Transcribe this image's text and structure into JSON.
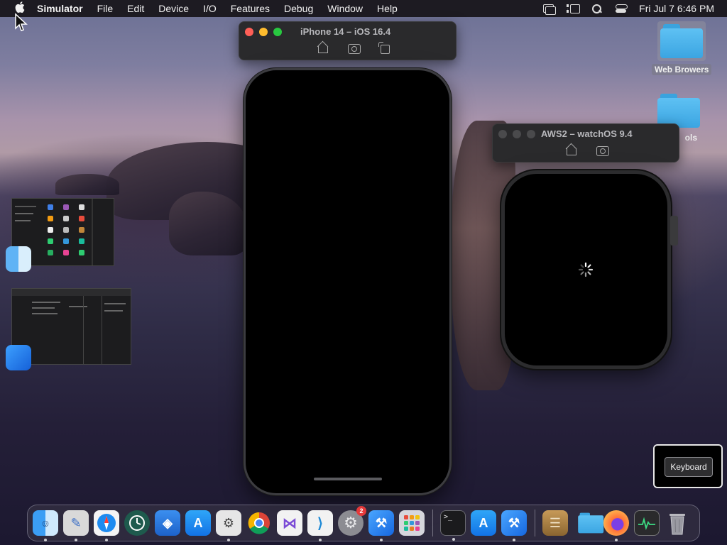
{
  "menubar": {
    "app_name": "Simulator",
    "items": [
      "File",
      "Edit",
      "Device",
      "I/O",
      "Features",
      "Debug",
      "Window",
      "Help"
    ],
    "clock": "Fri Jul 7  6:46 PM"
  },
  "iphone_sim": {
    "title": "iPhone 14 – iOS 16.4"
  },
  "watch_sim": {
    "title": "AWS2 – watchOS 9.4"
  },
  "desktop": {
    "folders": [
      {
        "label": "Web Browers"
      },
      {
        "label": "ols"
      }
    ]
  },
  "keyboard_panel": {
    "button_label": "Keyboard"
  },
  "dock": {
    "settings_badge": "2",
    "apps": [
      "finder",
      "sketch-pad",
      "safari",
      "time-machine",
      "cloud-app",
      "app-store",
      "xcode-instruments",
      "chrome",
      "visual-studio",
      "vscode",
      "system-settings",
      "xcode",
      "launchpad",
      "terminal",
      "app-store-2",
      "xcode-2",
      "archive-utility",
      "downloads-folder",
      "firefox",
      "activity-monitor",
      "trash"
    ]
  },
  "colors": {
    "traffic_red": "#ff5f57",
    "traffic_yellow": "#febc2e",
    "traffic_green": "#28c840",
    "folder_blue": "#3ba5e2"
  }
}
